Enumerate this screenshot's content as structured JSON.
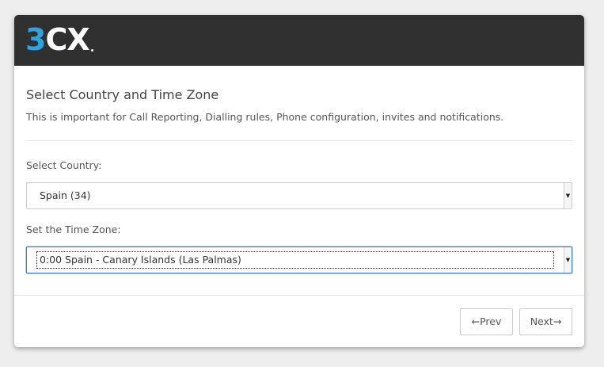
{
  "logo": {
    "part1": "3",
    "part2": "CX"
  },
  "page": {
    "title": "Select Country and Time Zone",
    "subtitle": "This is important for Call Reporting, Dialling rules, Phone configuration, invites and notifications."
  },
  "country": {
    "label": "Select Country:",
    "selected": "Spain (34)",
    "arrow": "▼"
  },
  "timezone": {
    "label": "Set the Time Zone:",
    "selected": "0:00 Spain - Canary Islands (Las Palmas)",
    "arrow": "▼"
  },
  "buttons": {
    "prev": "←Prev",
    "next": "Next→"
  },
  "colors": {
    "header_bg": "#303030",
    "logo_accent": "#2ea3e0",
    "focus_border": "#3a7fb8"
  }
}
